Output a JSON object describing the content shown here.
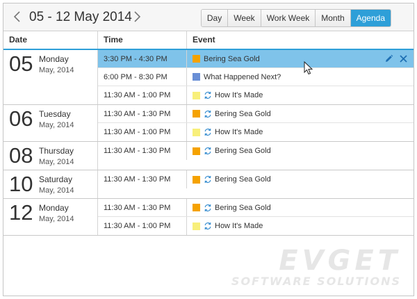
{
  "toolbar": {
    "date_range": "05 - 12 May 2014",
    "views": [
      {
        "label": "Day",
        "active": false
      },
      {
        "label": "Week",
        "active": false
      },
      {
        "label": "Work Week",
        "active": false
      },
      {
        "label": "Month",
        "active": false
      },
      {
        "label": "Agenda",
        "active": true
      }
    ]
  },
  "columns": {
    "date": "Date",
    "time": "Time",
    "event": "Event"
  },
  "colors": {
    "accent": "#2e9fd8",
    "selected_row": "#7fc3ea",
    "orange": "#f5a200",
    "blue": "#6a8fd6",
    "yellow": "#f8ef7a"
  },
  "days": [
    {
      "num": "05",
      "name": "Monday",
      "month": "May, 2014",
      "events": [
        {
          "time": "3:30 PM - 4:30 PM",
          "title": "Bering Sea Gold",
          "color": "orange",
          "recurring": false,
          "selected": true
        },
        {
          "time": "6:00 PM - 8:30 PM",
          "title": "What Happened Next?",
          "color": "blue",
          "recurring": false,
          "selected": false
        },
        {
          "time": "11:30 AM - 1:00 PM",
          "title": "How It's Made",
          "color": "yellow",
          "recurring": true,
          "selected": false
        }
      ]
    },
    {
      "num": "06",
      "name": "Tuesday",
      "month": "May, 2014",
      "events": [
        {
          "time": "11:30 AM - 1:30 PM",
          "title": "Bering Sea Gold",
          "color": "orange",
          "recurring": true,
          "selected": false
        },
        {
          "time": "11:30 AM - 1:00 PM",
          "title": "How It's Made",
          "color": "yellow",
          "recurring": true,
          "selected": false
        }
      ]
    },
    {
      "num": "08",
      "name": "Thursday",
      "month": "May, 2014",
      "events": [
        {
          "time": "11:30 AM - 1:30 PM",
          "title": "Bering Sea Gold",
          "color": "orange",
          "recurring": true,
          "selected": false
        }
      ]
    },
    {
      "num": "10",
      "name": "Saturday",
      "month": "May, 2014",
      "events": [
        {
          "time": "11:30 AM - 1:30 PM",
          "title": "Bering Sea Gold",
          "color": "orange",
          "recurring": true,
          "selected": false
        }
      ]
    },
    {
      "num": "12",
      "name": "Monday",
      "month": "May, 2014",
      "events": [
        {
          "time": "11:30 AM - 1:30 PM",
          "title": "Bering Sea Gold",
          "color": "orange",
          "recurring": true,
          "selected": false
        },
        {
          "time": "11:30 AM - 1:00 PM",
          "title": "How It's Made",
          "color": "yellow",
          "recurring": true,
          "selected": false
        }
      ]
    }
  ],
  "icons": {
    "prev": "chevron-left-icon",
    "next": "chevron-right-icon",
    "recurring": "recurrence-icon",
    "edit": "pencil-icon",
    "delete": "close-icon",
    "cursor": "mouse-cursor-icon"
  },
  "watermark": {
    "main": "EVGET",
    "sub": "SOFTWARE SOLUTIONS"
  }
}
